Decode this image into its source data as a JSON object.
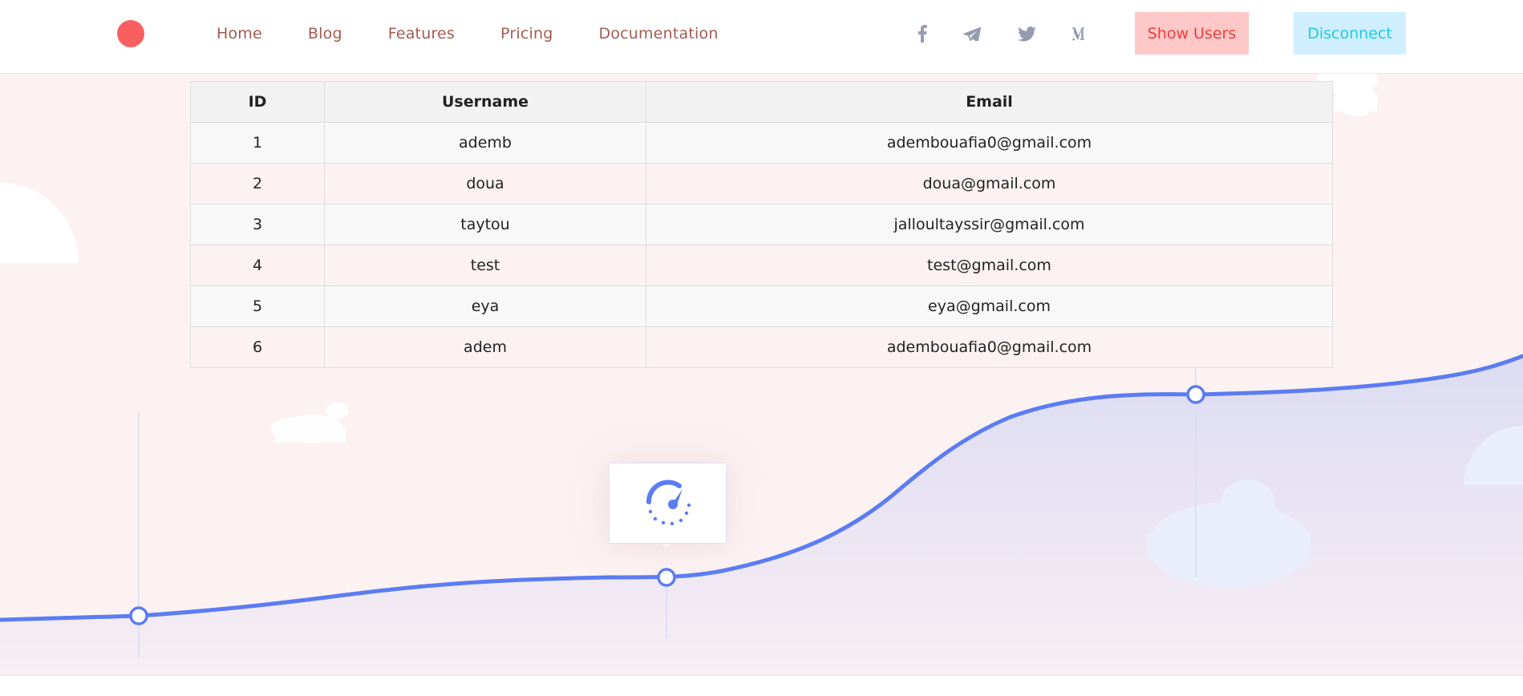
{
  "nav": {
    "links": [
      "Home",
      "Blog",
      "Features",
      "Pricing",
      "Documentation"
    ],
    "social_icons": [
      "facebook-icon",
      "telegram-icon",
      "twitter-icon",
      "medium-icon"
    ],
    "show_users_label": "Show Users",
    "disconnect_label": "Disconnect"
  },
  "colors": {
    "logo": "#f95f5f",
    "nav_link": "#a55a50",
    "show_users_bg": "#ffc8c8",
    "show_users_text": "#f23b3b",
    "disconnect_bg": "#cfefff",
    "disconnect_text": "#1ec8e6",
    "curve": "#5b7cf2",
    "hero_bg": "#fcf2f2"
  },
  "table": {
    "headers": [
      "ID",
      "Username",
      "Email"
    ],
    "rows": [
      {
        "id": "1",
        "username": "ademb",
        "email": "adembouafia0@gmail.com"
      },
      {
        "id": "2",
        "username": "doua",
        "email": "doua@gmail.com"
      },
      {
        "id": "3",
        "username": "taytou",
        "email": "jalloultayssir@gmail.com"
      },
      {
        "id": "4",
        "username": "test",
        "email": "test@gmail.com"
      },
      {
        "id": "5",
        "username": "eya",
        "email": "eya@gmail.com"
      },
      {
        "id": "6",
        "username": "adem",
        "email": "adembouafia0@gmail.com"
      }
    ]
  },
  "hero": {
    "gauge_icon": "speedometer-icon"
  }
}
